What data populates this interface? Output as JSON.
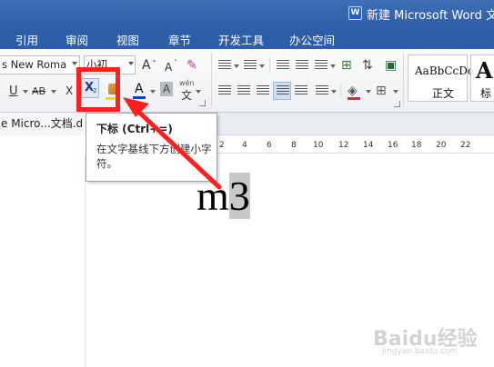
{
  "window": {
    "title": "新建 Microsoft Word 文",
    "app_icon": "W"
  },
  "menu": {
    "tabs": [
      "引用",
      "审阅",
      "视图",
      "章节",
      "开发工具",
      "办公空间"
    ]
  },
  "ribbon": {
    "font_name": "s New Roma",
    "font_size": "小初",
    "buttons": {
      "grow_font": "A",
      "shrink_font": "A",
      "underline": "U",
      "strikethrough": "AB",
      "superscript": "X",
      "subscript": "X",
      "subscript_sub": "2",
      "font_color": "A",
      "char_shading": "A",
      "phonetic_top": "wén",
      "phonetic_bottom": "文"
    },
    "styles": {
      "sample": "AaBbCcDc",
      "normal_label": "正文",
      "big_sample": "A",
      "big_label": "标"
    }
  },
  "document_tab": {
    "label": "e Micro...文档.d"
  },
  "ruler": {
    "numbers": [
      "2",
      "4",
      "6",
      "8",
      "10",
      "12",
      "14",
      "16",
      "18",
      "20",
      "22"
    ]
  },
  "document": {
    "text_main": "m",
    "text_selected": "3"
  },
  "tooltip": {
    "title": "下标 (Ctrl+=)",
    "body": "在文字基线下方创建小字符。"
  },
  "watermark": {
    "text": "Baidu经验",
    "url": "jingyan.baidu.com"
  },
  "colors": {
    "titlebar": "#2f5ea8",
    "annotation_red": "#ff1f1f",
    "font_color_bar": "#1a3cc9",
    "highlight_bar": "#ffd400",
    "selection": "#c8c8c8"
  }
}
